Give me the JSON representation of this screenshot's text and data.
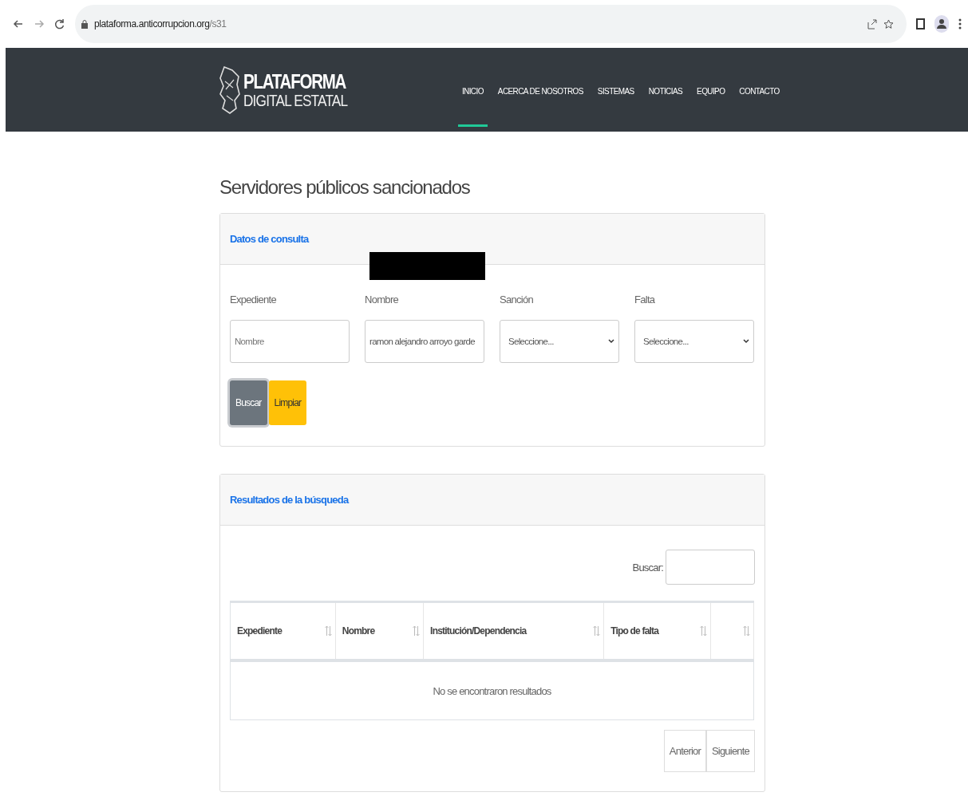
{
  "browser": {
    "url_host": "plataforma.anticorrupcion.org",
    "url_path": "/s31"
  },
  "brand": {
    "line_1": "PLATAFORMA",
    "line_2": "DIGITAL ESTATAL"
  },
  "nav": [
    {
      "label": "INICIO",
      "selected": true
    },
    {
      "label": "ACERCA DE NOSOTROS",
      "selected": false
    },
    {
      "label": "SISTEMAS",
      "selected": false
    },
    {
      "label": "NOTICIAS",
      "selected": false
    },
    {
      "label": "EQUIPO",
      "selected": false
    },
    {
      "label": "CONTACTO",
      "selected": false
    }
  ],
  "page_title": "Servidores públicos sancionados",
  "query_card": {
    "title": "Datos de consulta",
    "redacted": true,
    "fields": [
      {
        "label": "Expediente",
        "kind": "input",
        "placeholder": "Nombre"
      },
      {
        "label": "Nombre",
        "kind": "input",
        "value": "ramon alejandro arroyo garde"
      },
      {
        "label": "Sanción",
        "kind": "select",
        "value": "Seleccione..."
      },
      {
        "label": "Falta",
        "kind": "select",
        "value": "Seleccione..."
      }
    ],
    "buttons": [
      {
        "label": "Buscar",
        "kind": "secondary"
      },
      {
        "label": "Limpiar",
        "kind": "warning"
      }
    ]
  },
  "results_card": {
    "title": "Resultados de la búsqueda",
    "search_label": "Buscar:",
    "columns": [
      {
        "label": "Expediente"
      },
      {
        "label": "Nombre"
      },
      {
        "label": "Institución/Dependencia"
      },
      {
        "label": "Tipo de falta"
      },
      {}
    ],
    "empty_message": "No se encontraron resultados",
    "pagination": [
      "Anterior",
      "Siguiente"
    ]
  }
}
